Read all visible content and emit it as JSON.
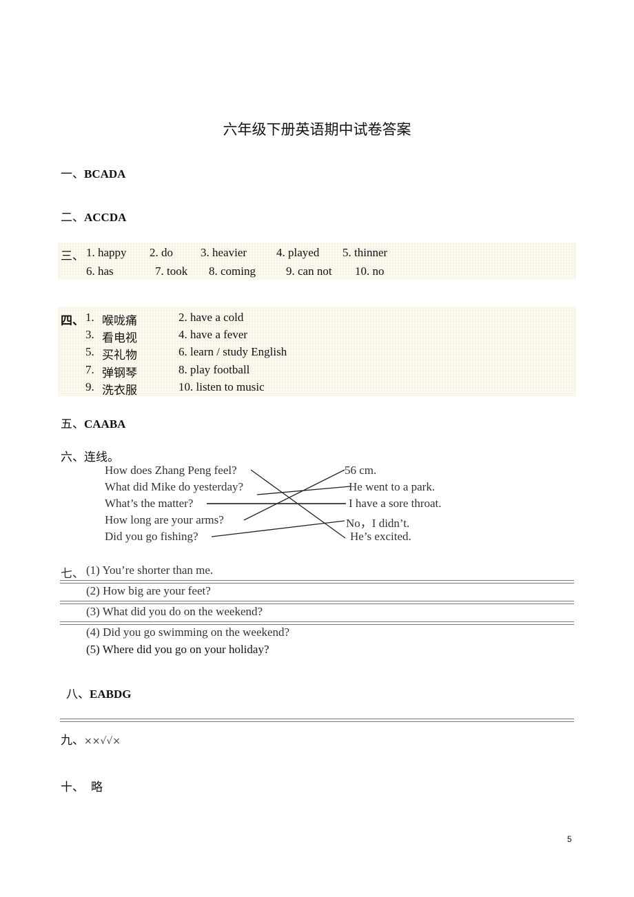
{
  "title": "六年级下册英语期中试卷答案",
  "sections": {
    "s1": {
      "num": "一、",
      "answer": "BCADA"
    },
    "s2": {
      "num": "二、",
      "answer": "ACCDA"
    },
    "s3": {
      "num": "三、",
      "items": [
        "1. happy",
        "2. do",
        "3. heavier",
        "4. played",
        "5. thinner",
        "6. has",
        "7. took",
        "8. coming",
        "9. can not",
        "10. no"
      ]
    },
    "s4": {
      "num": "四、",
      "items": [
        {
          "n": "1.",
          "cn": "喉咙痛",
          "en": "2. have a cold"
        },
        {
          "n": "3.",
          "cn": "看电视",
          "en": "4. have a fever"
        },
        {
          "n": "5.",
          "cn": "买礼物",
          "en": "6. learn / study English"
        },
        {
          "n": "7.",
          "cn": "弹钢琴",
          "en": "8. play football"
        },
        {
          "n": "9.",
          "cn": "洗衣服",
          "en": "10. listen to music"
        }
      ]
    },
    "s5": {
      "num": "五、",
      "answer": "CAABA"
    },
    "s6": {
      "num": "六、",
      "label": "连线。",
      "questions": [
        "How does Zhang Peng feel?",
        "What did Mike do yesterday?",
        "What’s the matter?",
        "How long are your arms?",
        "Did you go fishing?"
      ],
      "answers": [
        "56 cm.",
        "He went to a park.",
        "I have a sore throat.",
        "No，I didn’t.",
        "He’s excited."
      ],
      "matches": [
        [
          0,
          4
        ],
        [
          1,
          1
        ],
        [
          2,
          2
        ],
        [
          3,
          0
        ],
        [
          4,
          3
        ]
      ]
    },
    "s7": {
      "num": "七、",
      "items": [
        "(1) You’re shorter than me.",
        "(2) How big are your feet?",
        "(3) What did you do on the weekend?",
        "(4) Did you go swimming on the weekend?",
        "(5) Where did you go on your holiday?"
      ]
    },
    "s8": {
      "num": "八、",
      "answer": "EABDG"
    },
    "s9": {
      "num": "九、",
      "answer": "××√√×"
    },
    "s10": {
      "num": "十、",
      "answer": "略"
    }
  },
  "page_number": "5"
}
